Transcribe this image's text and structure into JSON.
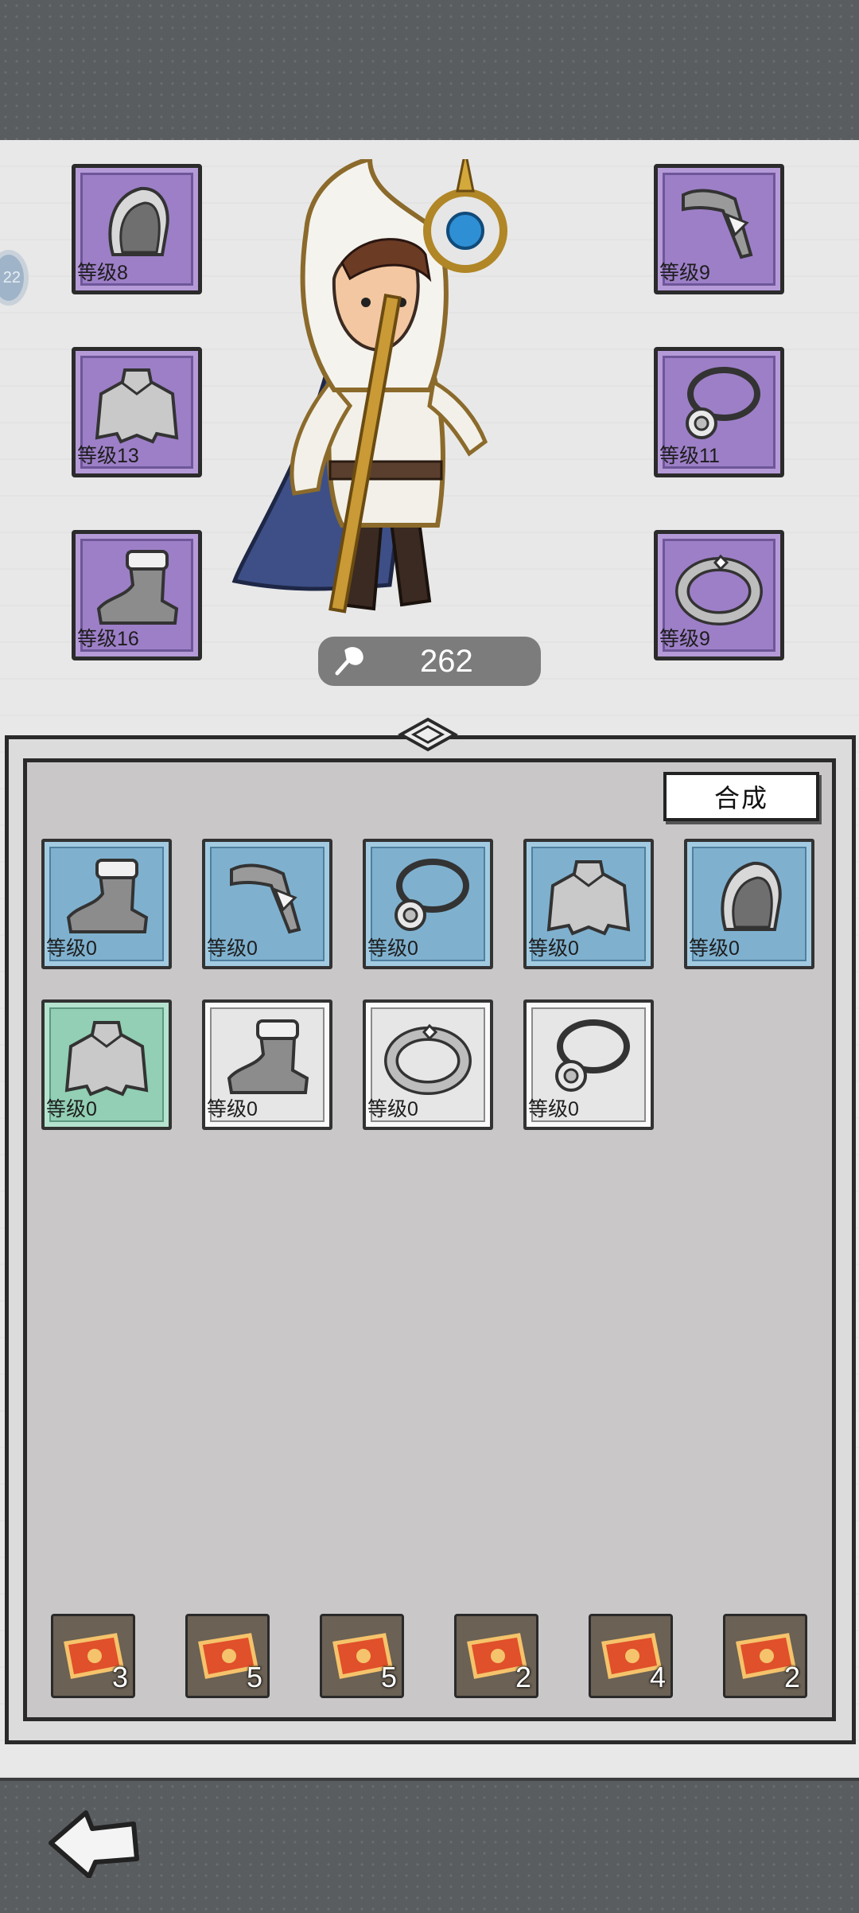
{
  "side_badge": "22",
  "equipped": [
    {
      "slot": "hood",
      "label": "等级8",
      "icon": "hood-icon"
    },
    {
      "slot": "cape",
      "label": "等级13",
      "icon": "cape-icon"
    },
    {
      "slot": "boots",
      "label": "等级16",
      "icon": "boot-icon"
    },
    {
      "slot": "staff",
      "label": "等级9",
      "icon": "staff-icon"
    },
    {
      "slot": "necklace",
      "label": "等级11",
      "icon": "necklace-icon"
    },
    {
      "slot": "ring",
      "label": "等级9",
      "icon": "ring-icon"
    }
  ],
  "power": {
    "value": "262",
    "icon": "power-icon"
  },
  "craft_button": "合成",
  "inventory": [
    {
      "rarity": "blue",
      "label": "等级0",
      "icon": "boot-icon"
    },
    {
      "rarity": "blue",
      "label": "等级0",
      "icon": "staff-icon"
    },
    {
      "rarity": "blue",
      "label": "等级0",
      "icon": "necklace-icon"
    },
    {
      "rarity": "blue",
      "label": "等级0",
      "icon": "cape-icon"
    },
    {
      "rarity": "blue",
      "label": "等级0",
      "icon": "hood-icon"
    },
    {
      "rarity": "green",
      "label": "等级0",
      "icon": "cape-icon"
    },
    {
      "rarity": "grey",
      "label": "等级0",
      "icon": "boot-icon"
    },
    {
      "rarity": "grey",
      "label": "等级0",
      "icon": "ring-icon"
    },
    {
      "rarity": "grey",
      "label": "等级0",
      "icon": "necklace-icon"
    }
  ],
  "scrolls": [
    {
      "count": "3",
      "icon": "scroll-icon"
    },
    {
      "count": "5",
      "icon": "scroll-icon"
    },
    {
      "count": "5",
      "icon": "scroll-icon"
    },
    {
      "count": "2",
      "icon": "scroll-icon"
    },
    {
      "count": "4",
      "icon": "scroll-icon"
    },
    {
      "count": "2",
      "icon": "scroll-icon"
    }
  ],
  "colors": {
    "equipped_slot": "#9d7fc7",
    "blue": "#7fb1cf",
    "green": "#92cfb4",
    "grey": "#e6e6e6"
  }
}
